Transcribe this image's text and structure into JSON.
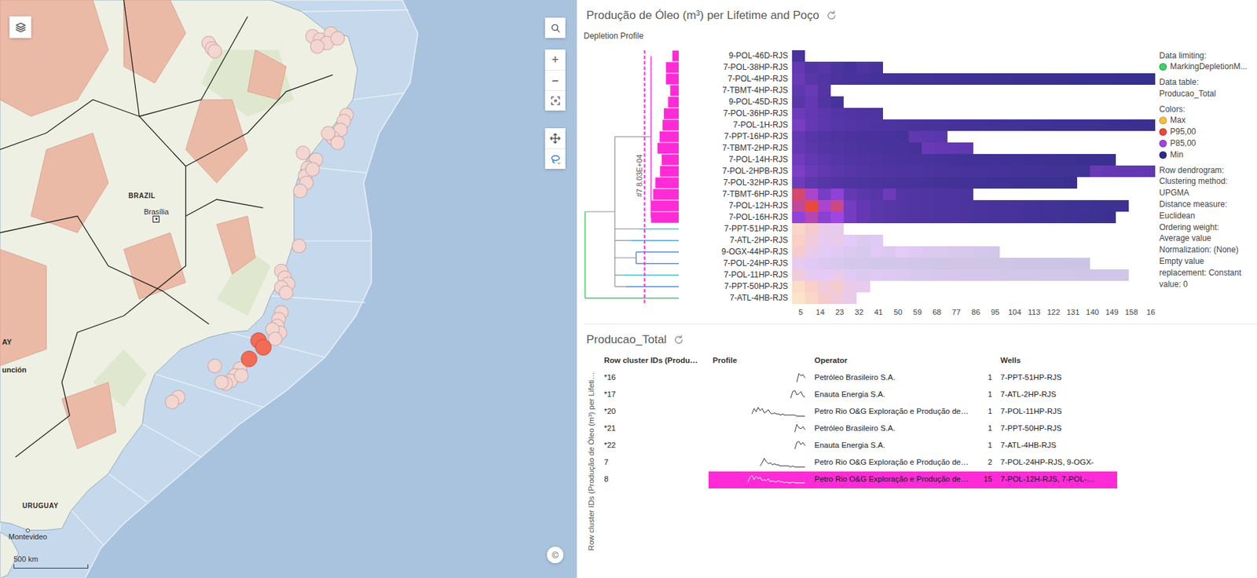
{
  "map": {
    "controls": {
      "zoom_in": "+",
      "zoom_out": "−",
      "attribution": "©"
    },
    "scale": "500 km",
    "labels": [
      {
        "text": "BRAZIL",
        "lat": -14.8,
        "lon": -49.7,
        "kind": "country"
      },
      {
        "text": "Brasília",
        "lat": -16.3,
        "lon": -47.9,
        "kind": "capital"
      },
      {
        "text": "URUGUAY",
        "lat": -33.45,
        "lon": -56.55,
        "kind": "country"
      },
      {
        "text": "Montevideo",
        "lat": -34.9,
        "lon": -56.2,
        "kind": "city"
      },
      {
        "text": "AY",
        "lat": -23.6,
        "lon": -57.9,
        "kind": "edge"
      },
      {
        "text": "unción",
        "lat": -25.3,
        "lon": -57.9,
        "kind": "edge"
      }
    ],
    "markers": [
      {
        "lat": -5.6,
        "lon": -44.5,
        "selected": false
      },
      {
        "lat": -5.9,
        "lon": -44.3,
        "selected": false
      },
      {
        "lat": -6.1,
        "lon": -44.1,
        "selected": false
      },
      {
        "lat": -5.2,
        "lon": -37.8,
        "selected": false
      },
      {
        "lat": -5.4,
        "lon": -37.3,
        "selected": false
      },
      {
        "lat": -5.0,
        "lon": -36.6,
        "selected": false
      },
      {
        "lat": -5.6,
        "lon": -36.9,
        "selected": false
      },
      {
        "lat": -5.8,
        "lon": -37.5,
        "selected": false
      },
      {
        "lat": -5.3,
        "lon": -36.2,
        "selected": false
      },
      {
        "lat": -9.9,
        "lon": -35.6,
        "selected": false
      },
      {
        "lat": -10.3,
        "lon": -35.8,
        "selected": false
      },
      {
        "lat": -10.8,
        "lon": -36.0,
        "selected": false
      },
      {
        "lat": -11.3,
        "lon": -36.5,
        "selected": false
      },
      {
        "lat": -11.0,
        "lon": -36.8,
        "selected": false
      },
      {
        "lat": -11.6,
        "lon": -36.2,
        "selected": false
      },
      {
        "lat": -12.6,
        "lon": -37.6,
        "selected": false
      },
      {
        "lat": -13.1,
        "lon": -38.1,
        "selected": false
      },
      {
        "lat": -13.6,
        "lon": -38.3,
        "selected": false
      },
      {
        "lat": -13.2,
        "lon": -37.8,
        "selected": false
      },
      {
        "lat": -14.0,
        "lon": -38.2,
        "selected": false
      },
      {
        "lat": -12.2,
        "lon": -38.4,
        "selected": false
      },
      {
        "lat": -14.5,
        "lon": -38.6,
        "selected": false
      },
      {
        "lat": -17.8,
        "lon": -38.7,
        "selected": false
      },
      {
        "lat": -19.3,
        "lon": -39.8,
        "selected": false
      },
      {
        "lat": -19.7,
        "lon": -39.6,
        "selected": false
      },
      {
        "lat": -20.1,
        "lon": -39.4,
        "selected": false
      },
      {
        "lat": -20.3,
        "lon": -39.8,
        "selected": false
      },
      {
        "lat": -20.6,
        "lon": -39.5,
        "selected": false
      },
      {
        "lat": -21.8,
        "lon": -39.8,
        "selected": false
      },
      {
        "lat": -22.2,
        "lon": -40.0,
        "selected": false
      },
      {
        "lat": -22.6,
        "lon": -40.1,
        "selected": false
      },
      {
        "lat": -23.0,
        "lon": -39.9,
        "selected": false
      },
      {
        "lat": -22.8,
        "lon": -40.4,
        "selected": false
      },
      {
        "lat": -23.4,
        "lon": -40.2,
        "selected": false
      },
      {
        "lat": -25.2,
        "lon": -42.5,
        "selected": false
      },
      {
        "lat": -25.6,
        "lon": -42.8,
        "selected": false
      },
      {
        "lat": -25.9,
        "lon": -43.1,
        "selected": false
      },
      {
        "lat": -26.1,
        "lon": -43.4,
        "selected": false
      },
      {
        "lat": -26.0,
        "lon": -43.7,
        "selected": false
      },
      {
        "lat": -25.6,
        "lon": -42.4,
        "selected": false
      },
      {
        "lat": -25.0,
        "lon": -44.1,
        "selected": false
      },
      {
        "lat": -26.9,
        "lon": -46.5,
        "selected": false
      },
      {
        "lat": -27.2,
        "lon": -46.9,
        "selected": false
      },
      {
        "lat": -23.5,
        "lon": -41.3,
        "selected": true
      },
      {
        "lat": -23.9,
        "lon": -41.0,
        "selected": true
      },
      {
        "lat": -24.6,
        "lon": -41.9,
        "selected": true
      }
    ]
  },
  "heatmap": {
    "title": "Produção de Óleo (m³) per Lifetime and Poço",
    "subtitle": "Depletion Profile",
    "dendrogram": {
      "cut": 80300,
      "cut_label": "#7 8.03E+04",
      "max": 220000,
      "joins": [
        150000,
        220000
      ]
    },
    "x_max": 168,
    "bin": 6,
    "x_ticks": [
      {
        "label": "5",
        "value": 5
      },
      {
        "label": "14",
        "value": 14
      },
      {
        "label": "23",
        "value": 23
      },
      {
        "label": "32",
        "value": 32
      },
      {
        "label": "41",
        "value": 41
      },
      {
        "label": "50",
        "value": 50
      },
      {
        "label": "59",
        "value": 59
      },
      {
        "label": "68",
        "value": 68
      },
      {
        "label": "77",
        "value": 77
      },
      {
        "label": "86",
        "value": 86
      },
      {
        "label": "95",
        "value": 95
      },
      {
        "label": "104",
        "value": 104
      },
      {
        "label": "113",
        "value": 113
      },
      {
        "label": "122",
        "value": 122
      },
      {
        "label": "131",
        "value": 131
      },
      {
        "label": "140",
        "value": 140
      },
      {
        "label": "149",
        "value": 149
      },
      {
        "label": "158",
        "value": 158
      },
      {
        "label": "16",
        "value": 167
      }
    ],
    "scale": [
      {
        "label": "Max",
        "color": "#f6c43c",
        "value": 2500
      },
      {
        "label": "P95,00",
        "color": "#ea4a3c",
        "value": 1500
      },
      {
        "label": "P85,00",
        "color": "#a045e4",
        "value": 800
      },
      {
        "label": "Min",
        "color": "#2b2d84",
        "value": 0
      }
    ],
    "legend": {
      "limiting_title": "Data limiting:",
      "limiting": {
        "label": "MarkingDepletionM...",
        "color": "#3bd36b"
      },
      "table_title": "Data table:",
      "table": "Producao_Total",
      "colors_title": "Colors:",
      "notes": [
        "Row dendrogram:",
        "Clustering method:",
        "UPGMA",
        "Distance measure:",
        "Euclidean",
        "Ordering weight:",
        "Average value",
        "Normalization: (None)",
        "Empty value replacement: Constant value: 0"
      ]
    },
    "rows": [
      {
        "label": "9-POL-46D-RJS",
        "cluster": "8",
        "selected": true,
        "merge": 15000,
        "color": "#ff2bd6",
        "values": [
          210
        ]
      },
      {
        "label": "7-POL-38HP-RJS",
        "cluster": "8",
        "selected": true,
        "merge": 30000,
        "color": "#ff2bd6",
        "values": [
          380,
          260,
          300,
          220,
          180,
          240,
          200
        ]
      },
      {
        "label": "7-POL-4HP-RJS",
        "cluster": "8",
        "selected": true,
        "merge": 30000,
        "color": "#ff2bd6",
        "values": [
          420,
          300,
          260,
          220,
          200,
          190,
          180,
          170,
          160,
          150,
          150,
          140,
          140,
          130,
          130,
          120,
          120,
          110,
          110,
          100,
          100,
          100,
          90,
          90,
          90,
          80,
          80,
          80
        ]
      },
      {
        "label": "7-TBMT-4HP-RJS",
        "cluster": "8",
        "selected": true,
        "merge": 20000,
        "color": "#ff2bd6",
        "values": [
          350,
          420,
          280
        ]
      },
      {
        "label": "9-POL-45D-RJS",
        "cluster": "8",
        "selected": true,
        "merge": 25000,
        "color": "#ff2bd6",
        "values": [
          300,
          380,
          250,
          200
        ]
      },
      {
        "label": "7-POL-36HP-RJS",
        "cluster": "8",
        "selected": true,
        "merge": 35000,
        "color": "#ff2bd6",
        "values": [
          450,
          380,
          320,
          280,
          260,
          240,
          230
        ]
      },
      {
        "label": "7-POL-1H-RJS",
        "cluster": "8",
        "selected": true,
        "merge": 38000,
        "color": "#ff2bd6",
        "values": [
          520,
          400,
          340,
          300,
          280,
          260,
          240,
          230,
          220,
          210,
          200,
          190,
          180,
          170,
          170,
          160,
          150,
          150,
          140,
          140,
          130,
          130,
          120,
          120,
          110,
          110,
          100,
          100
        ]
      },
      {
        "label": "7-PPT-16HP-RJS",
        "cluster": "8",
        "selected": true,
        "merge": 45000,
        "color": "#ff2bd6",
        "values": [
          380,
          300,
          260,
          240,
          220,
          200,
          200,
          190,
          180,
          360,
          340,
          320
        ]
      },
      {
        "label": "7-TBMT-2HP-RJS",
        "cluster": "8",
        "selected": true,
        "merge": 50000,
        "color": "#ff2bd6",
        "values": [
          400,
          330,
          280,
          260,
          240,
          220,
          210,
          200,
          190,
          180,
          420,
          400,
          380,
          360
        ]
      },
      {
        "label": "7-POL-14H-RJS",
        "cluster": "8",
        "selected": true,
        "merge": 40000,
        "color": "#ff2bd6",
        "values": [
          480,
          380,
          320,
          290,
          270,
          250,
          230,
          220,
          210,
          200,
          190,
          180,
          170,
          160,
          160,
          150,
          140,
          140,
          130,
          130,
          120,
          120,
          110,
          110,
          100
        ]
      },
      {
        "label": "7-POL-2HPB-RJS",
        "cluster": "8",
        "selected": true,
        "merge": 44000,
        "color": "#ff2bd6",
        "values": [
          560,
          430,
          360,
          320,
          300,
          280,
          260,
          250,
          240,
          230,
          220,
          210,
          200,
          200,
          190,
          180,
          180,
          170,
          170,
          160,
          160,
          150,
          150,
          420,
          400,
          380,
          380,
          360
        ]
      },
      {
        "label": "7-POL-32HP-RJS",
        "cluster": "8",
        "selected": true,
        "merge": 55000,
        "color": "#ff2bd6",
        "values": [
          460,
          350,
          300,
          270,
          250,
          230,
          220,
          210,
          200,
          190,
          180,
          170,
          160,
          160,
          150,
          140,
          140,
          130,
          130,
          120,
          120,
          110
        ]
      },
      {
        "label": "7-TBMT-6HP-RJS",
        "cluster": "8",
        "selected": true,
        "merge": 60000,
        "color": "#ff2bd6",
        "values": [
          1300,
          900,
          520,
          700,
          400,
          330,
          300,
          460,
          280,
          260,
          250,
          240,
          230,
          220
        ]
      },
      {
        "label": "7-POL-12H-RJS",
        "cluster": "8",
        "selected": true,
        "merge": 65000,
        "color": "#ff2bd6",
        "values": [
          1100,
          1500,
          900,
          1200,
          500,
          380,
          330,
          300,
          280,
          260,
          250,
          240,
          230,
          220,
          210,
          200,
          190,
          180,
          170,
          160,
          150,
          140,
          140,
          130,
          120,
          120
        ]
      },
      {
        "label": "7-POL-16H-RJS",
        "cluster": "8",
        "selected": true,
        "merge": 65000,
        "color": "#ff2bd6",
        "values": [
          700,
          1000,
          650,
          800,
          500,
          380,
          330,
          300,
          280,
          260,
          250,
          240,
          230,
          220,
          210,
          200,
          190,
          180,
          170,
          160,
          150,
          140,
          130,
          120,
          110
        ]
      },
      {
        "label": "7-PPT-51HP-RJS",
        "cluster": "*16",
        "selected": false,
        "merge": 95000,
        "color": "#3bbfcf",
        "values": [
          1800,
          1400,
          1000,
          900
        ]
      },
      {
        "label": "7-ATL-2HP-RJS",
        "cluster": "*17",
        "selected": false,
        "merge": 112000,
        "color": "#3ba6d6",
        "values": [
          1600,
          1200,
          900,
          1000,
          800,
          600,
          700
        ]
      },
      {
        "label": "9-OGX-44HP-RJS",
        "cluster": "7",
        "selected": false,
        "merge": 100000,
        "color": "#4a86d9",
        "values": [
          1400,
          1000,
          800,
          700,
          600,
          500,
          700,
          600,
          800,
          700,
          600,
          600,
          500,
          500,
          450,
          400
        ]
      },
      {
        "label": "7-POL-24HP-RJS",
        "cluster": "7",
        "selected": false,
        "merge": 100000,
        "color": "#4a86d9",
        "values": [
          900,
          700,
          600,
          500,
          450,
          420,
          400,
          380,
          360,
          340,
          320,
          300,
          300,
          280,
          280,
          260,
          260,
          240,
          240,
          220,
          220,
          200,
          200
        ]
      },
      {
        "label": "7-POL-11HP-RJS",
        "cluster": "*20",
        "selected": false,
        "merge": 130000,
        "color": "#3bbfcf",
        "values": [
          1200,
          900,
          800,
          1000,
          700,
          600,
          700,
          650,
          600,
          550,
          500,
          480,
          460,
          450,
          440,
          420,
          400,
          390,
          380,
          370,
          360,
          350,
          340,
          330,
          320,
          310
        ]
      },
      {
        "label": "7-PPT-50HP-RJS",
        "cluster": "*21",
        "selected": false,
        "merge": 125000,
        "color": "#4a86d9",
        "values": [
          2000,
          1600,
          1200,
          1400,
          1000,
          900
        ]
      },
      {
        "label": "7-ATL-4HB-RJS",
        "cluster": "*22",
        "selected": false,
        "merge": 220000,
        "color": "#3cc25a",
        "values": [
          2200,
          1800,
          1400,
          1200,
          1000
        ]
      }
    ]
  },
  "table": {
    "title": "Producao_Total",
    "axis_label": "Row cluster IDs (Produção de Óleo (m³) per Lifeti…",
    "columns": {
      "cluster": "Row cluster IDs (Produ…",
      "profile": "Profile",
      "operator": "Operator",
      "wells": "Wells"
    },
    "rows": [
      {
        "cluster": "*16",
        "profile": [
          1,
          9,
          7,
          8,
          5
        ],
        "operator": "Petróleo Brasileiro S.A.",
        "count": "1",
        "wells": "7-PPT-51HP-RJS",
        "selected": false
      },
      {
        "cluster": "*17",
        "profile": [
          2,
          8,
          9,
          5,
          6,
          8,
          4,
          3
        ],
        "operator": "Enauta Energia S.A.",
        "count": "1",
        "wells": "7-ATL-2HP-RJS",
        "selected": false
      },
      {
        "cluster": "*20",
        "profile": [
          3,
          8,
          5,
          9,
          6,
          8,
          4,
          5,
          7,
          4,
          3,
          4,
          3,
          3,
          2,
          3,
          2,
          2,
          2,
          2,
          2,
          2,
          1,
          1,
          1,
          1,
          1
        ],
        "operator": "Petro Rio O&G Exploração e Produção de…",
        "count": "1",
        "wells": "7-POL-11HP-RJS",
        "selected": false
      },
      {
        "cluster": "*21",
        "profile": [
          2,
          9,
          6,
          5,
          7,
          4
        ],
        "operator": "Petróleo Brasileiro S.A.",
        "count": "1",
        "wells": "7-PPT-50HP-RJS",
        "selected": false
      },
      {
        "cluster": "*22",
        "profile": [
          2,
          8,
          9,
          6,
          8,
          5
        ],
        "operator": "Enauta Energia S.A.",
        "count": "1",
        "wells": "7-ATL-4HB-RJS",
        "selected": false
      },
      {
        "cluster": "7",
        "profile": [
          2,
          5,
          9,
          6,
          4,
          5,
          3,
          4,
          3,
          3,
          2,
          2,
          2,
          2,
          2,
          1,
          2,
          1,
          1,
          1,
          1,
          1,
          1
        ],
        "operator": "Petro Rio O&G Exploração e Produção de…",
        "count": "2",
        "wells": "7-POL-24HP-RJS, 9-OGX-",
        "selected": false
      },
      {
        "cluster": "8",
        "profile": [
          3,
          7,
          9,
          5,
          8,
          6,
          7,
          4,
          5,
          4,
          6,
          3,
          4,
          3,
          3,
          4,
          3,
          3,
          2,
          3,
          2,
          2,
          3,
          2,
          2,
          2,
          2,
          2,
          2
        ],
        "operator": "Petro Rio O&G Exploração e Produção de…",
        "count": "15",
        "wells": "7-POL-12H-RJS, 7-POL-…",
        "selected": true
      }
    ]
  }
}
